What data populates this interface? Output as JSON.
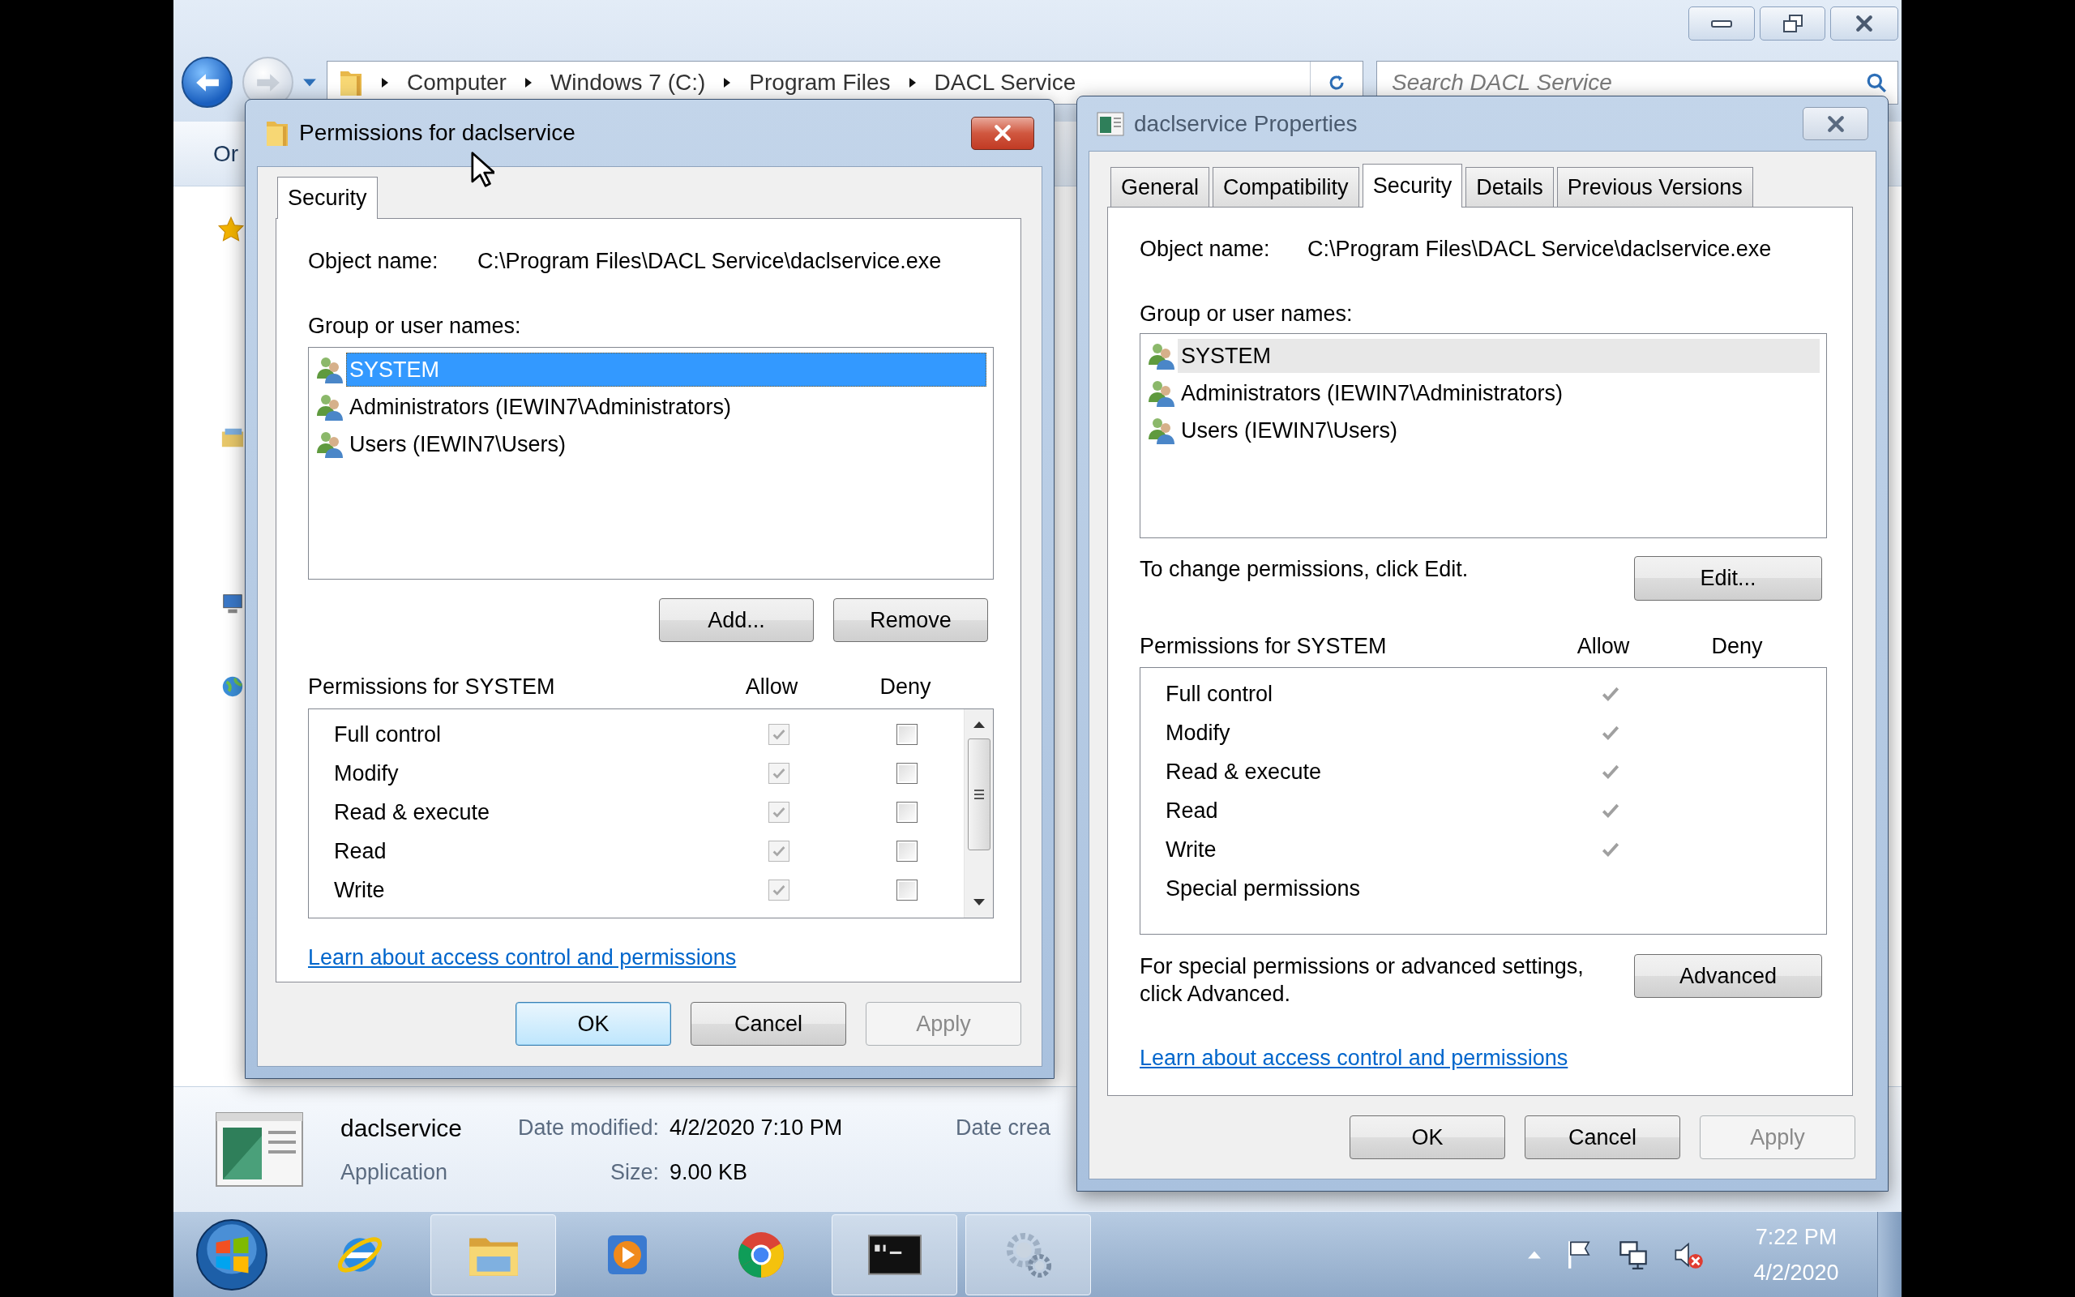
{
  "explorer": {
    "breadcrumb": [
      "Computer",
      "Windows 7 (C:)",
      "Program Files",
      "DACL Service"
    ],
    "search": {
      "placeholder": "Search DACL Service"
    },
    "toolbar": [
      "Or"
    ],
    "details": {
      "name": "daclservice",
      "type": "Application",
      "fields": [
        {
          "label": "Date modified:",
          "value": "4/2/2020 7:10 PM"
        },
        {
          "label": "Size:",
          "value": "9.00 KB"
        }
      ],
      "extra_label": "Date crea"
    }
  },
  "permissions_dialog": {
    "title": "Permissions for daclservice",
    "active": true,
    "tabs": [
      {
        "label": "Security",
        "selected": true
      }
    ],
    "object_label": "Object name:",
    "object_name": "C:\\Program Files\\DACL Service\\daclservice.exe",
    "group_label": "Group or user names:",
    "users": [
      {
        "name": "SYSTEM",
        "selected": true
      },
      {
        "name": "Administrators (IEWIN7\\Administrators)",
        "selected": false
      },
      {
        "name": "Users (IEWIN7\\Users)",
        "selected": false
      }
    ],
    "list_buttons": [
      "Add...",
      "Remove"
    ],
    "permissions_label": "Permissions for SYSTEM",
    "allow_label": "Allow",
    "deny_label": "Deny",
    "permissions": [
      {
        "name": "Full control",
        "allow": true,
        "allow_disabled": true,
        "deny": false
      },
      {
        "name": "Modify",
        "allow": true,
        "allow_disabled": true,
        "deny": false
      },
      {
        "name": "Read & execute",
        "allow": true,
        "allow_disabled": true,
        "deny": false
      },
      {
        "name": "Read",
        "allow": true,
        "allow_disabled": true,
        "deny": false
      },
      {
        "name": "Write",
        "allow": true,
        "allow_disabled": true,
        "deny": false
      }
    ],
    "link": "Learn about access control and permissions",
    "buttons": [
      {
        "label": "OK",
        "default": true,
        "disabled": false
      },
      {
        "label": "Cancel",
        "default": false,
        "disabled": false
      },
      {
        "label": "Apply",
        "default": false,
        "disabled": true
      }
    ]
  },
  "properties_dialog": {
    "title": "daclservice Properties",
    "active": false,
    "tabs": [
      {
        "label": "General",
        "selected": false
      },
      {
        "label": "Compatibility",
        "selected": false
      },
      {
        "label": "Security",
        "selected": true
      },
      {
        "label": "Details",
        "selected": false
      },
      {
        "label": "Previous Versions",
        "selected": false
      }
    ],
    "object_label": "Object name:",
    "object_name": "C:\\Program Files\\DACL Service\\daclservice.exe",
    "group_label": "Group or user names:",
    "users": [
      {
        "name": "SYSTEM",
        "selected": true
      },
      {
        "name": "Administrators (IEWIN7\\Administrators)",
        "selected": false
      },
      {
        "name": "Users (IEWIN7\\Users)",
        "selected": false
      }
    ],
    "edit_hint": "To change permissions, click Edit.",
    "edit_button": "Edit...",
    "permissions_label": "Permissions for SYSTEM",
    "allow_label": "Allow",
    "deny_label": "Deny",
    "permissions": [
      {
        "name": "Full control",
        "allow": true,
        "deny": false
      },
      {
        "name": "Modify",
        "allow": true,
        "deny": false
      },
      {
        "name": "Read & execute",
        "allow": true,
        "deny": false
      },
      {
        "name": "Read",
        "allow": true,
        "deny": false
      },
      {
        "name": "Write",
        "allow": true,
        "deny": false
      },
      {
        "name": "Special permissions",
        "allow": false,
        "deny": false
      }
    ],
    "advanced_hint": "For special permissions or advanced settings, click Advanced.",
    "advanced_button": "Advanced",
    "link": "Learn about access control and permissions",
    "buttons": [
      {
        "label": "OK",
        "default": false,
        "disabled": false
      },
      {
        "label": "Cancel",
        "default": false,
        "disabled": false
      },
      {
        "label": "Apply",
        "default": false,
        "disabled": true
      }
    ]
  },
  "taskbar": {
    "apps": [
      {
        "kind": "ie",
        "open": false
      },
      {
        "kind": "explorer",
        "open": true
      },
      {
        "kind": "media",
        "open": false
      },
      {
        "kind": "browser",
        "open": false
      },
      {
        "kind": "terminal",
        "open": true
      },
      {
        "kind": "gears",
        "open": true
      }
    ],
    "clock": {
      "time": "7:22 PM",
      "date": "4/2/2020"
    }
  }
}
